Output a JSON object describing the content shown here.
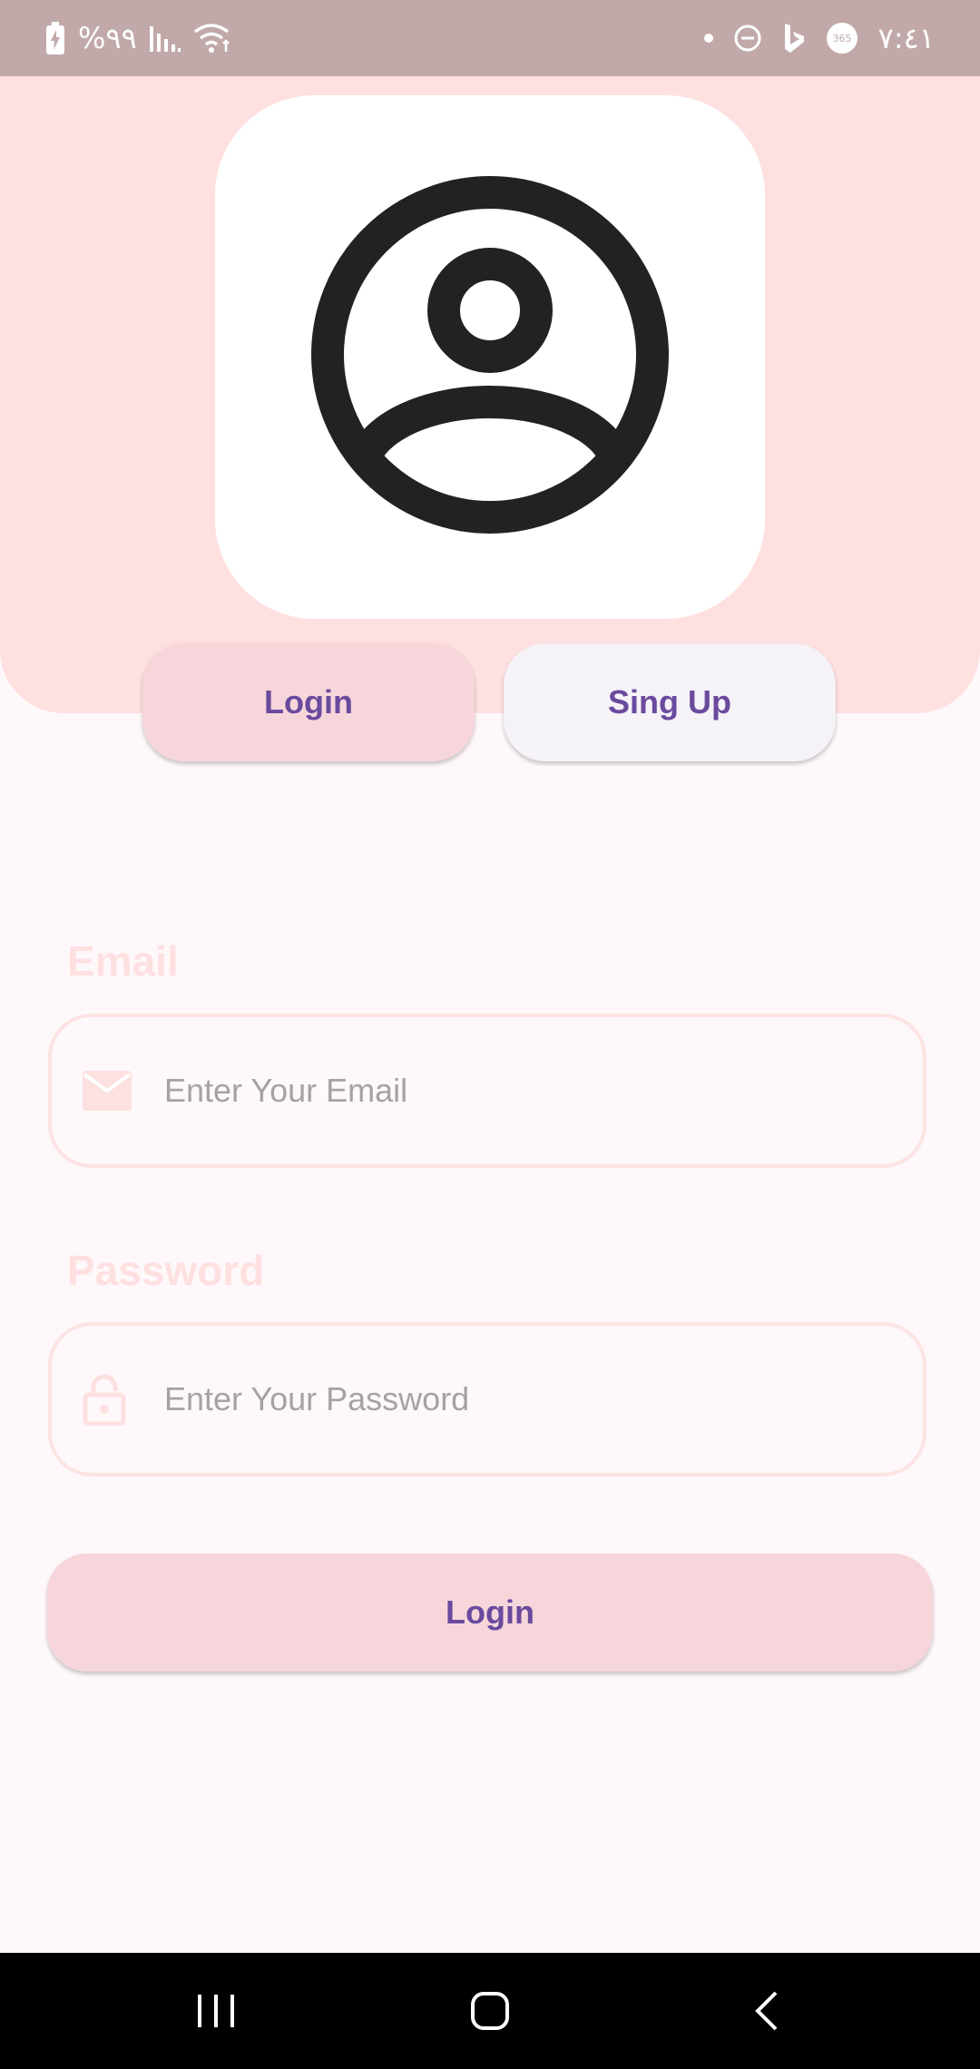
{
  "status_bar": {
    "battery_text": "%٩٩",
    "time": "٧:٤١",
    "icons": [
      "battery-charging-icon",
      "signal-icon",
      "wifi-icon",
      "dot-icon",
      "do-not-disturb-icon",
      "bing-icon",
      "office365-icon"
    ]
  },
  "header": {
    "avatar_icon": "account-circle-icon",
    "tabs": [
      {
        "label": "Login"
      },
      {
        "label": "Sing Up"
      }
    ]
  },
  "form": {
    "email": {
      "label": "Email",
      "placeholder": "Enter Your Email",
      "value": "",
      "icon": "mail-icon"
    },
    "password": {
      "label": "Password",
      "placeholder": "Enter Your Password",
      "value": "",
      "icon": "lock-icon"
    },
    "submit_label": "Login"
  },
  "nav_bar": {
    "buttons": [
      "recents-icon",
      "home-icon",
      "back-icon"
    ]
  },
  "colors": {
    "header_background": "#ffe0e0",
    "page_background": "#fff8fb",
    "button_text": "#6a4a9d",
    "active_tab": "#f6d6da",
    "inactive_tab": "#f5f2f8",
    "field_border": "#fde3e3",
    "status_bar": "#c2a9a9"
  }
}
